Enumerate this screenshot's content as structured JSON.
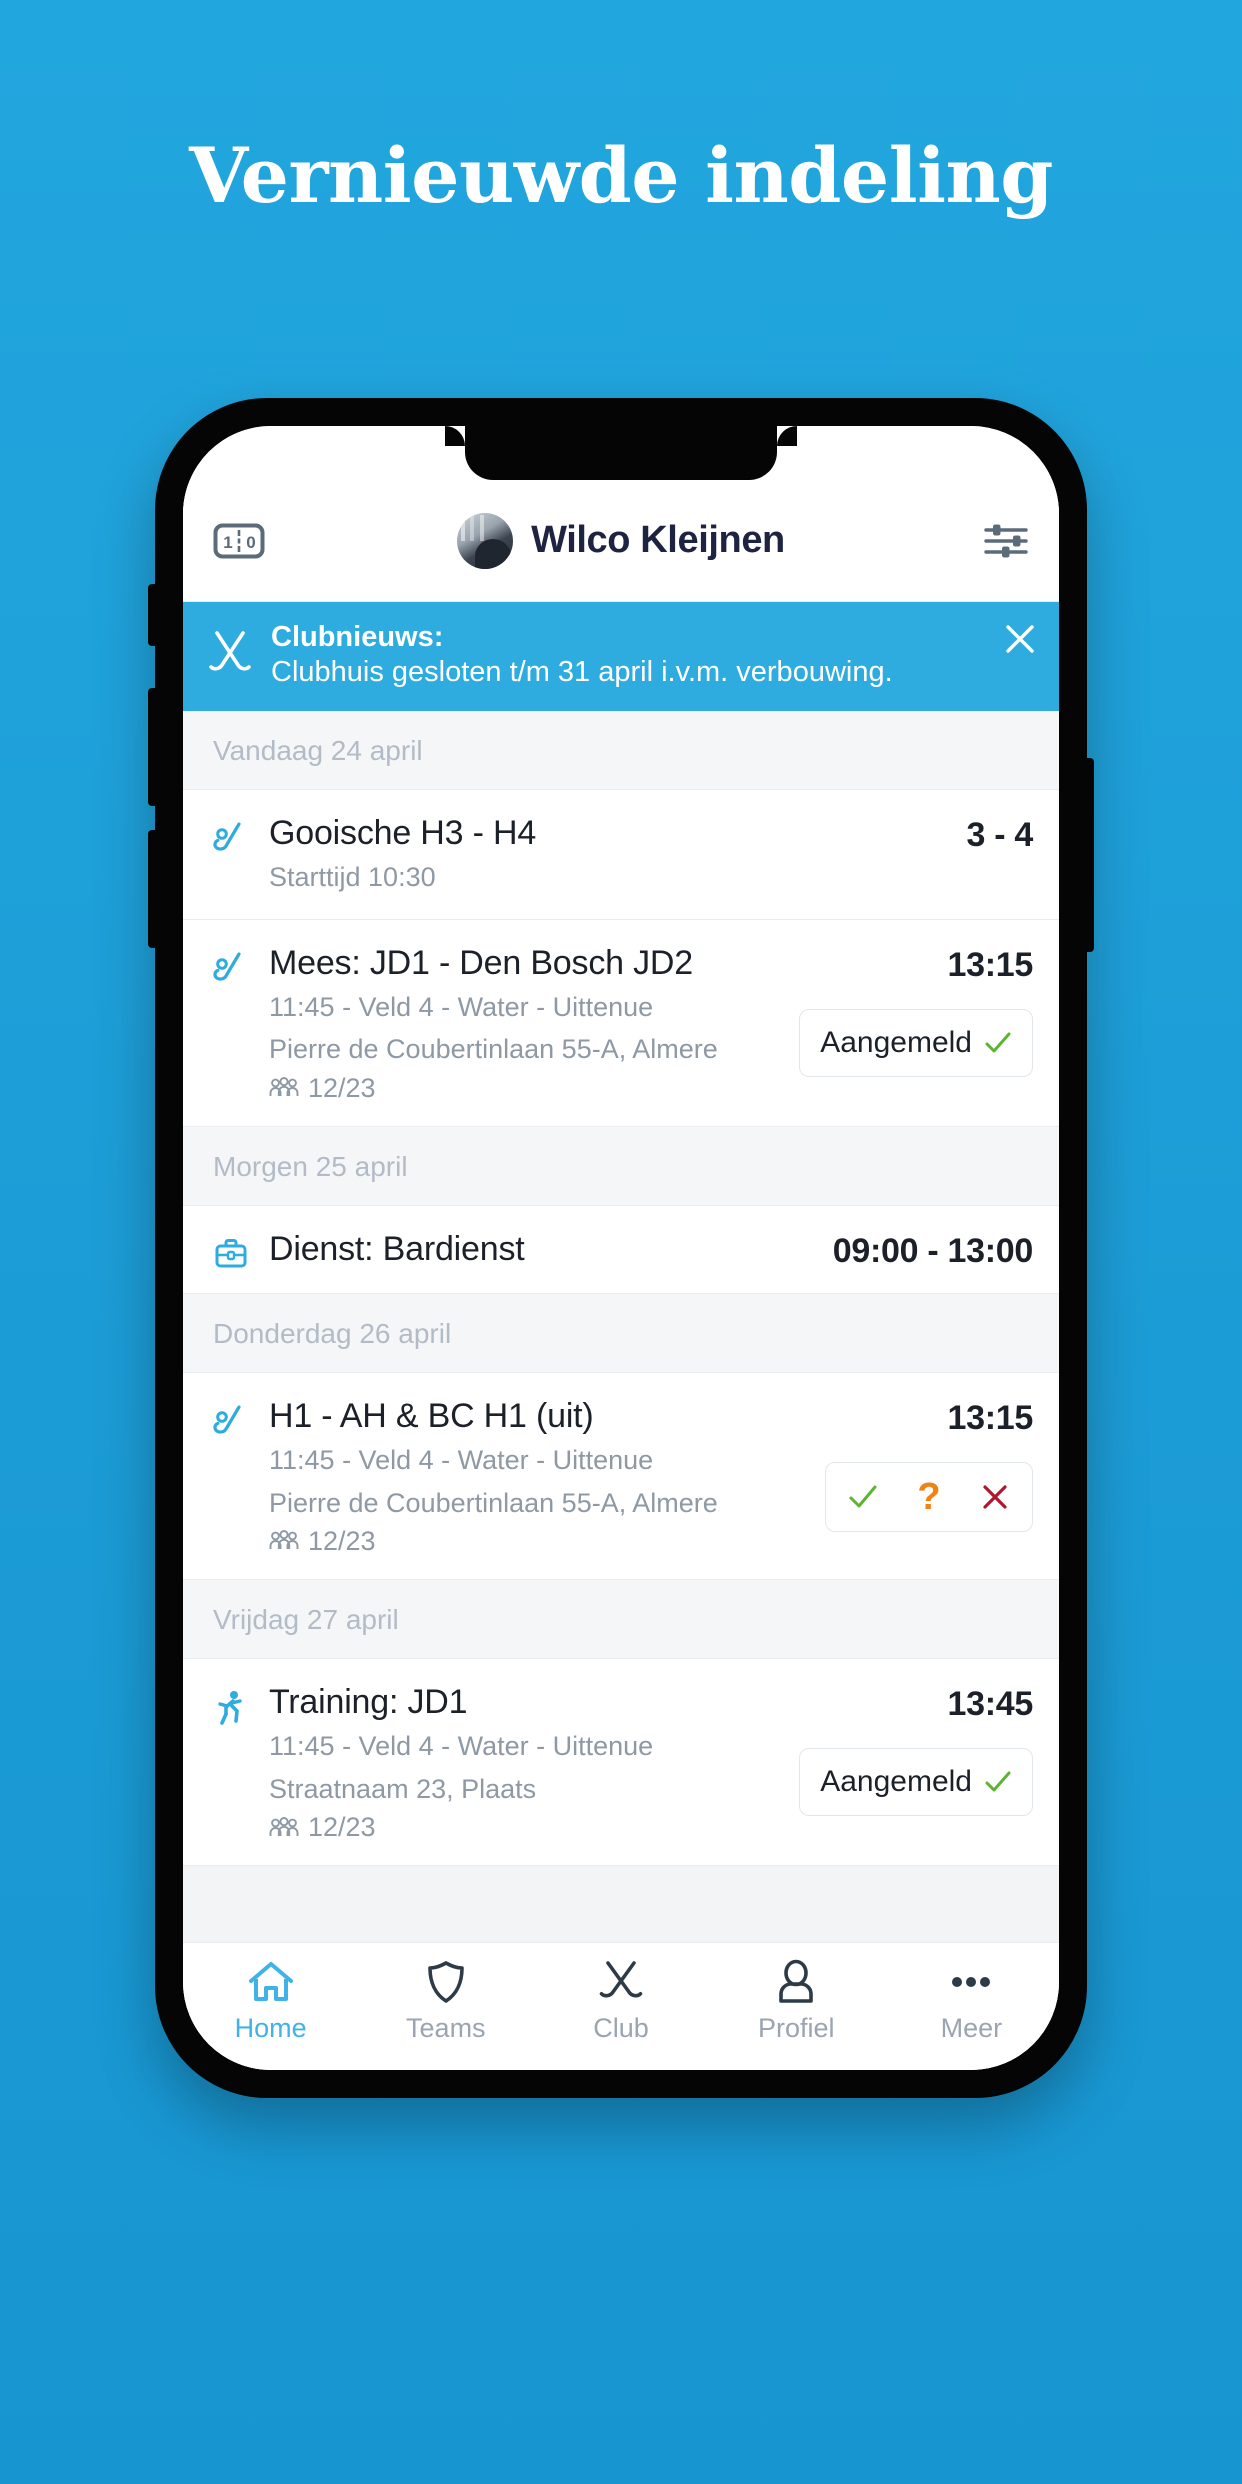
{
  "poster": {
    "title": "Vernieuwde indeling",
    "background_color": "#1fa2da"
  },
  "app": {
    "header": {
      "scoreboard_icon": "scoreboard-icon",
      "scoreboard_home": "1",
      "scoreboard_away": "0",
      "avatar_alt": "profile-photo",
      "user_name": "Wilco Kleijnen",
      "settings_icon": "sliders-icon"
    },
    "banner": {
      "icon": "crossed-sticks-icon",
      "title": "Clubnieuws:",
      "message": "Clubhuis gesloten t/m 31 april i.v.m. verbouwing.",
      "close_icon": "close-icon",
      "background_color": "#2eacdf"
    },
    "sections": [
      {
        "day_label": "Vandaag 24 april",
        "items": [
          {
            "icon": "hockey-stick-ball-icon",
            "title": "Gooische H3 - H4",
            "lines": [
              "Starttijd 10:30"
            ],
            "attendance": null,
            "right_value": "3 - 4",
            "action": null
          },
          {
            "icon": "hockey-stick-ball-icon",
            "title": "Mees: JD1 - Den Bosch JD2",
            "lines": [
              "11:45 - Veld 4 - Water - Uittenue",
              "Pierre de Coubertinlaan 55-A, Almere"
            ],
            "attendance": "12/23",
            "right_value": "13:15",
            "action": {
              "type": "registered",
              "label": "Aangemeld",
              "check_icon": "check-icon"
            }
          }
        ]
      },
      {
        "day_label": "Morgen 25 april",
        "items": [
          {
            "icon": "toolbox-icon",
            "title": "Dienst: Bardienst",
            "lines": [],
            "attendance": null,
            "right_value": "09:00 - 13:00",
            "action": null
          }
        ]
      },
      {
        "day_label": "Donderdag 26 april",
        "items": [
          {
            "icon": "hockey-stick-ball-icon",
            "title": "H1 - AH & BC H1 (uit)",
            "lines": [
              "11:45 - Veld 4 - Water - Uittenue",
              "Pierre de Coubertinlaan 55-A, Almere"
            ],
            "attendance": "12/23",
            "right_value": "13:15",
            "action": {
              "type": "rsvp",
              "yes_icon": "check-icon",
              "maybe_icon": "question-mark-icon",
              "maybe_label": "?",
              "no_icon": "cross-icon",
              "yes_color": "#5cb431",
              "maybe_color": "#ef8316",
              "no_color": "#b0172b"
            }
          }
        ]
      },
      {
        "day_label": "Vrijdag 27 april",
        "items": [
          {
            "icon": "running-person-icon",
            "title": "Training: JD1",
            "lines": [
              "11:45 - Veld 4 - Water - Uittenue",
              "Straatnaam 23, Plaats"
            ],
            "attendance": "12/23",
            "right_value": "13:45",
            "action": {
              "type": "registered",
              "label": "Aangemeld",
              "check_icon": "check-icon"
            }
          }
        ]
      }
    ],
    "tabbar": {
      "active_color": "#3fb3e8",
      "inactive_color": "#9aa5b1",
      "items": [
        {
          "label": "Home",
          "icon": "home-icon",
          "active": true
        },
        {
          "label": "Teams",
          "icon": "shield-icon",
          "active": false
        },
        {
          "label": "Club",
          "icon": "crossed-sticks-icon",
          "active": false
        },
        {
          "label": "Profiel",
          "icon": "person-icon",
          "active": false
        },
        {
          "label": "Meer",
          "icon": "ellipsis-icon",
          "active": false
        }
      ]
    }
  }
}
